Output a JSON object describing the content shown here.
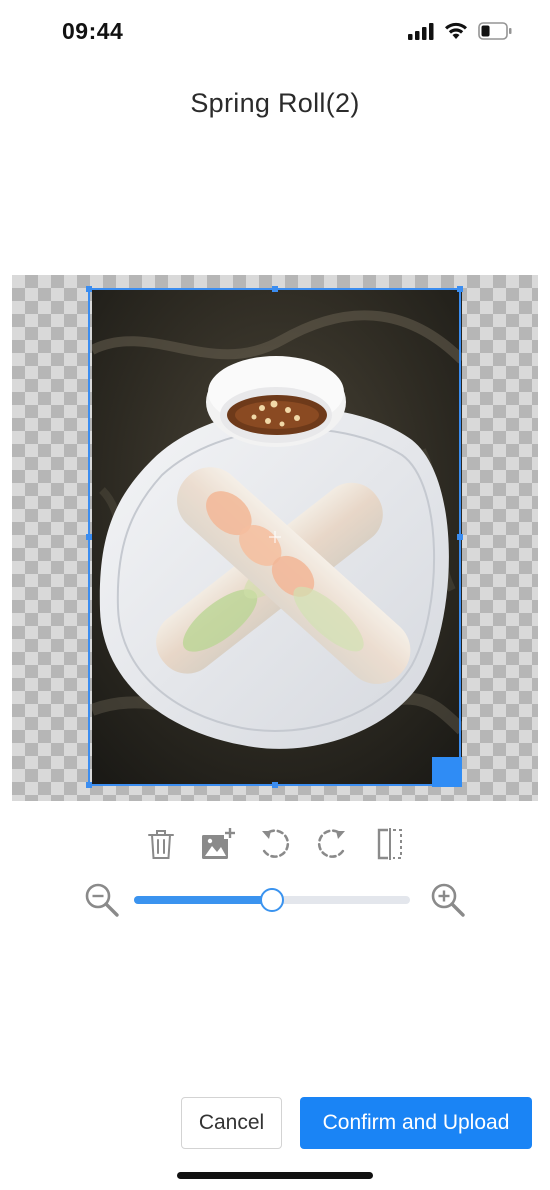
{
  "status_bar": {
    "time": "09:44",
    "icons": [
      "signal-icon",
      "wifi-icon",
      "battery-icon"
    ],
    "battery_level": 0.35
  },
  "header": {
    "title": "Spring Roll(2)"
  },
  "editor": {
    "image_subject": "spring-rolls-photo",
    "toolbar": {
      "tools": [
        "trash-icon",
        "add-image-icon",
        "rotate-left-icon",
        "rotate-right-icon",
        "flip-horizontal-icon"
      ]
    },
    "zoom": {
      "level": 0.5,
      "zoom_out_icon": "zoom-out-icon",
      "zoom_in_icon": "zoom-in-icon"
    }
  },
  "footer": {
    "cancel_label": "Cancel",
    "confirm_label": "Confirm and Upload"
  },
  "colors": {
    "accent": "#1a84f5",
    "crop_border": "#3b8df0",
    "icon_gray": "#8a8a8a"
  }
}
